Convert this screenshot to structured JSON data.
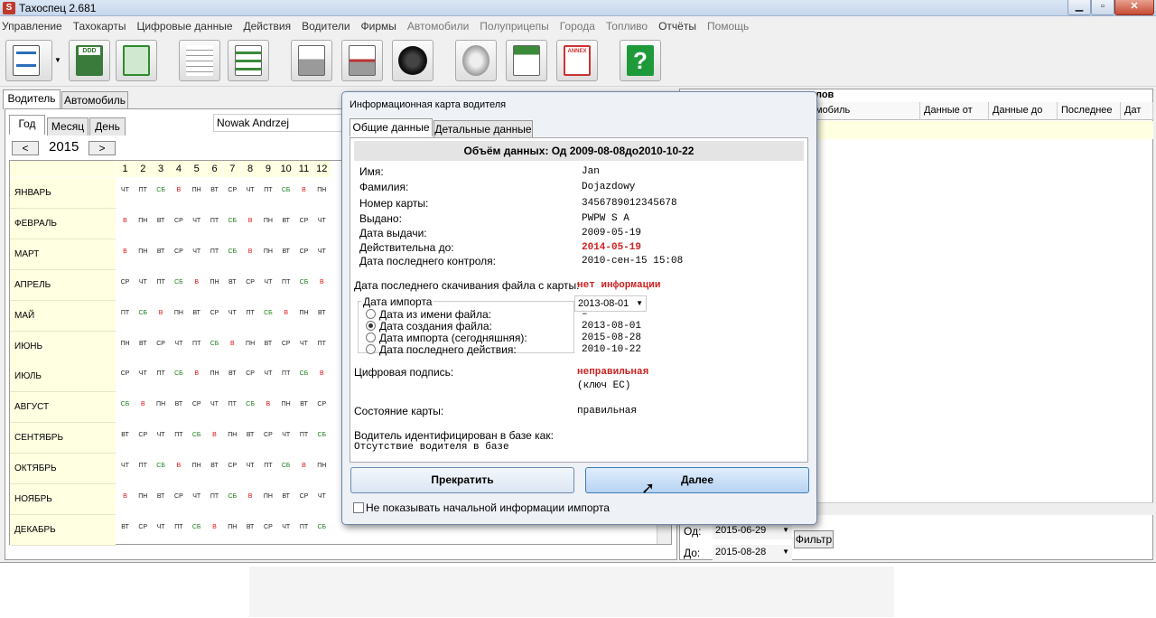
{
  "window": {
    "title": "Тахоспец 2.681",
    "icon": "app-logo-icon"
  },
  "menu": [
    {
      "label": "Управление",
      "enabled": true
    },
    {
      "label": "Тахокарты",
      "enabled": true
    },
    {
      "label": "Цифровые данные",
      "enabled": true
    },
    {
      "label": "Действия",
      "enabled": true
    },
    {
      "label": "Водители",
      "enabled": true
    },
    {
      "label": "Фирмы",
      "enabled": true
    },
    {
      "label": "Автомобили",
      "enabled": false
    },
    {
      "label": "Полуприцепы",
      "enabled": false
    },
    {
      "label": "Города",
      "enabled": false
    },
    {
      "label": "Топливо",
      "enabled": false
    },
    {
      "label": "Отчёты",
      "enabled": true
    },
    {
      "label": "Помощь",
      "enabled": false
    }
  ],
  "toolbar": {
    "ddd_label": "DDD",
    "annex_label": "ANNEX",
    "help_label": "?"
  },
  "left": {
    "tabs": [
      "Водитель",
      "Автомобиль"
    ],
    "period_tabs": [
      "Год",
      "Месяц",
      "День"
    ],
    "driver": "Nowak Andrzej",
    "year": "2015",
    "prev": "<",
    "next": ">",
    "day_numbers": [
      "1",
      "2",
      "3",
      "4",
      "5",
      "6",
      "7",
      "8",
      "9",
      "10",
      "11",
      "12"
    ],
    "months": [
      "ЯНВАРЬ",
      "ФЕВРАЛЬ",
      "МАРТ",
      "АПРЕЛЬ",
      "МАЙ",
      "ИЮНЬ",
      "ИЮЛЬ",
      "АВГУСТ",
      "СЕНТЯБРЬ",
      "ОКТЯБРЬ",
      "НОЯБРЬ",
      "ДЕКАБРЬ"
    ],
    "weekdays": [
      [
        "ЧТ",
        "ПТ",
        "СБ",
        "В",
        "ПН",
        "ВТ",
        "СР",
        "ЧТ",
        "ПТ",
        "СБ",
        "В",
        "ПН"
      ],
      [
        "В",
        "ПН",
        "ВТ",
        "СР",
        "ЧТ",
        "ПТ",
        "СБ",
        "В",
        "ПН",
        "ВТ",
        "СР",
        "ЧТ"
      ],
      [
        "В",
        "ПН",
        "ВТ",
        "СР",
        "ЧТ",
        "ПТ",
        "СБ",
        "В",
        "ПН",
        "ВТ",
        "СР",
        "ЧТ"
      ],
      [
        "СР",
        "ЧТ",
        "ПТ",
        "СБ",
        "В",
        "ПН",
        "ВТ",
        "СР",
        "ЧТ",
        "ПТ",
        "СБ",
        "В"
      ],
      [
        "ПТ",
        "СБ",
        "В",
        "ПН",
        "ВТ",
        "СР",
        "ЧТ",
        "ПТ",
        "СБ",
        "В",
        "ПН",
        "ВТ"
      ],
      [
        "ПН",
        "ВТ",
        "СР",
        "ЧТ",
        "ПТ",
        "СБ",
        "В",
        "ПН",
        "ВТ",
        "СР",
        "ЧТ",
        "ПТ"
      ],
      [
        "СР",
        "ЧТ",
        "ПТ",
        "СБ",
        "В",
        "ПН",
        "ВТ",
        "СР",
        "ЧТ",
        "ПТ",
        "СБ",
        "В"
      ],
      [
        "СБ",
        "В",
        "ПН",
        "ВТ",
        "СР",
        "ЧТ",
        "ПТ",
        "СБ",
        "В",
        "ПН",
        "ВТ",
        "СР"
      ],
      [
        "ВТ",
        "СР",
        "ЧТ",
        "ПТ",
        "СБ",
        "В",
        "ПН",
        "ВТ",
        "СР",
        "ЧТ",
        "ПТ",
        "СБ"
      ],
      [
        "ЧТ",
        "ПТ",
        "СБ",
        "В",
        "ПН",
        "ВТ",
        "СР",
        "ЧТ",
        "ПТ",
        "СБ",
        "В",
        "ПН"
      ],
      [
        "В",
        "ПН",
        "ВТ",
        "СР",
        "ЧТ",
        "ПТ",
        "СБ",
        "В",
        "ПН",
        "ВТ",
        "СР",
        "ЧТ"
      ],
      [
        "ВТ",
        "СР",
        "ЧТ",
        "ПТ",
        "СБ",
        "В",
        "ПН",
        "ВТ",
        "СР",
        "ЧТ",
        "ПТ",
        "СБ"
      ]
    ]
  },
  "right": {
    "header_partial": "лов",
    "columns": [
      "мобиль",
      "Данные от",
      "Данные до",
      "Последнее",
      "Дат"
    ],
    "from_label": "Од:",
    "from_value": "2015-06-29",
    "to_label": "До:",
    "to_value": "2015-08-28",
    "filter_label": "Фильтр"
  },
  "dialog": {
    "title": "Информационная карта водителя",
    "tabs": [
      "Общие данные",
      "Детальные данные"
    ],
    "header": "Объём данных: Од 2009-08-08до2010-10-22",
    "fields": [
      {
        "label": "Имя:",
        "value": "Jan",
        "warn": false
      },
      {
        "label": "Фамилия:",
        "value": "Dojazdowy",
        "warn": false
      },
      {
        "label": "Номер карты:",
        "value": "3456789012345678",
        "warn": false
      },
      {
        "label": "Выдано:",
        "value": "PWPW S A",
        "warn": false
      },
      {
        "label": "Дата выдачи:",
        "value": "2009-05-19",
        "warn": false
      },
      {
        "label": "Действительна до:",
        "value": "2014-05-19",
        "warn": true
      },
      {
        "label": "Дата последнего контроля:",
        "value": "2010-сен-15 15:08",
        "warn": false
      }
    ],
    "last_download_label": "Дата последнего скачивания файла с карты:",
    "last_download_value": "нет информации",
    "import_group_label": "Дата импорта",
    "import_select": "2013-08-01",
    "import_options": [
      {
        "label": "Дата из имени файла:",
        "value": "–",
        "selected": false
      },
      {
        "label": "Дата создания файла:",
        "value": "2013-08-01",
        "selected": true
      },
      {
        "label": "Дата импорта (сегодняшняя):",
        "value": "2015-08-28",
        "selected": false
      },
      {
        "label": "Дата последнего действия:",
        "value": "2010-10-22",
        "selected": false
      }
    ],
    "signature_label": "Цифровая подпись:",
    "signature_value": "неправильная",
    "signature_note": "(ключ ЕС)",
    "card_state_label": "Состояние карты:",
    "card_state_value": "правильная",
    "identified_label": "Водитель идентифицирован в базе как:",
    "identified_value": "Отсутствие водителя в базе",
    "cancel_label": "Прекратить",
    "next_label": "Далее",
    "checkbox_label": "Не показывать начальной информации импорта",
    "checkbox_checked": false
  }
}
